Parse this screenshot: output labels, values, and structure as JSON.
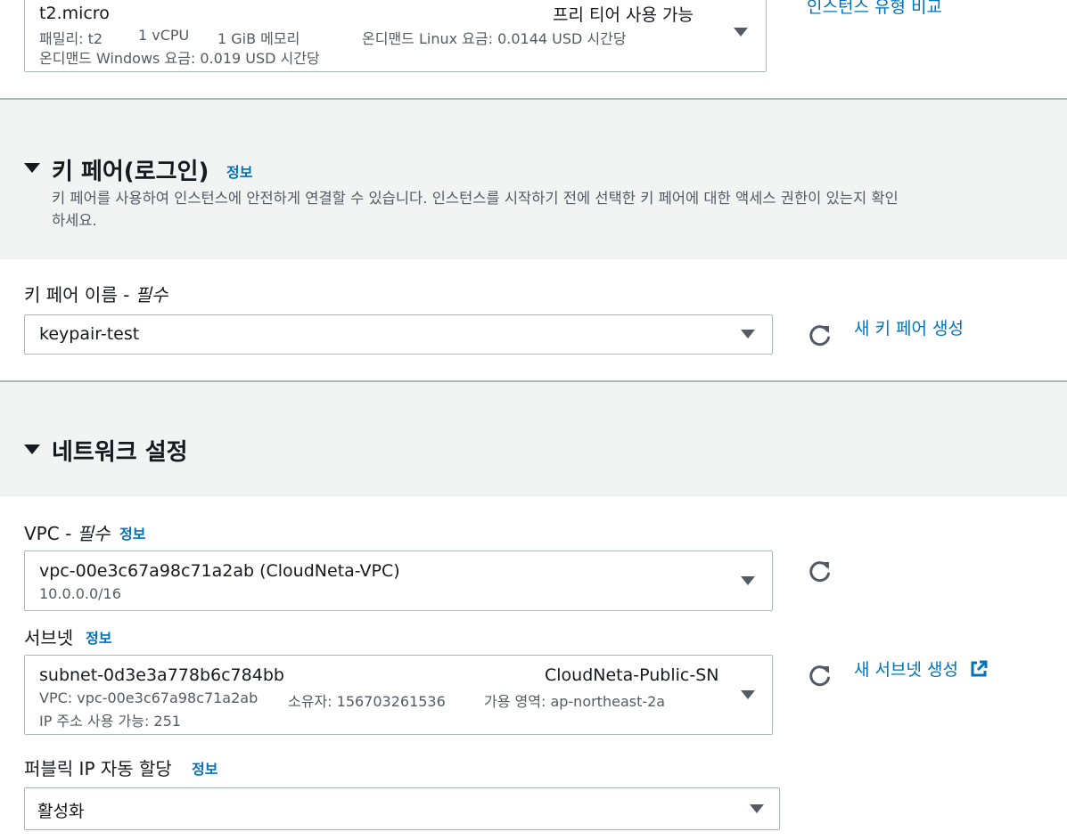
{
  "instance_type": {
    "name": "t2.micro",
    "free_tier": "프리 티어 사용 가능",
    "family": "패밀리: t2",
    "vcpu": "1 vCPU",
    "memory": "1 GiB 메모리",
    "linux_price": "온디맨드 Linux 요금: 0.0144 USD 시간당",
    "windows_price": "온디맨드 Windows 요금: 0.019 USD 시간당",
    "compare_link": "인스턴스 유형 비교"
  },
  "key_pair": {
    "title": "키 페어(로그인)",
    "info": "정보",
    "description_line1": "키 페어를 사용하여 인스턴스에 안전하게 연결할 수 있습니다. 인스턴스를 시작하기 전에 선택한 키 페어에 대한 액세스 권한이 있는지 확인",
    "description_line2": "하세요.",
    "field_label": "키 페어 이름 - ",
    "required": "필수",
    "selected": "keypair-test",
    "create_link": "새 키 페어 생성"
  },
  "network": {
    "title": "네트워크 설정",
    "vpc": {
      "label": "VPC - ",
      "required": "필수",
      "info": "정보",
      "selected": "vpc-00e3c67a98c71a2ab (CloudNeta-VPC)",
      "cidr": "10.0.0.0/16"
    },
    "subnet": {
      "label": "서브넷",
      "info": "정보",
      "selected": "subnet-0d3e3a778b6c784bb",
      "name": "CloudNeta-Public-SN",
      "vpc": "VPC: vpc-00e3c67a98c71a2ab",
      "owner": "소유자: 156703261536",
      "az": "가용 영역: ap-northeast-2a",
      "available_ips": "IP 주소 사용 가능: 251",
      "create_link": "새 서브넷 생성"
    },
    "public_ip": {
      "label": "퍼블릭 IP 자동 할당",
      "info": "정보",
      "selected": "활성화"
    }
  },
  "colors": {
    "link": "#0073bb",
    "band": "#f2f3f3",
    "border": "#aab7b8",
    "text": "#16191f",
    "muted": "#545b64"
  },
  "icons": [
    "chevron-down-icon",
    "refresh-icon",
    "external-link-icon",
    "section-expand-icon"
  ]
}
